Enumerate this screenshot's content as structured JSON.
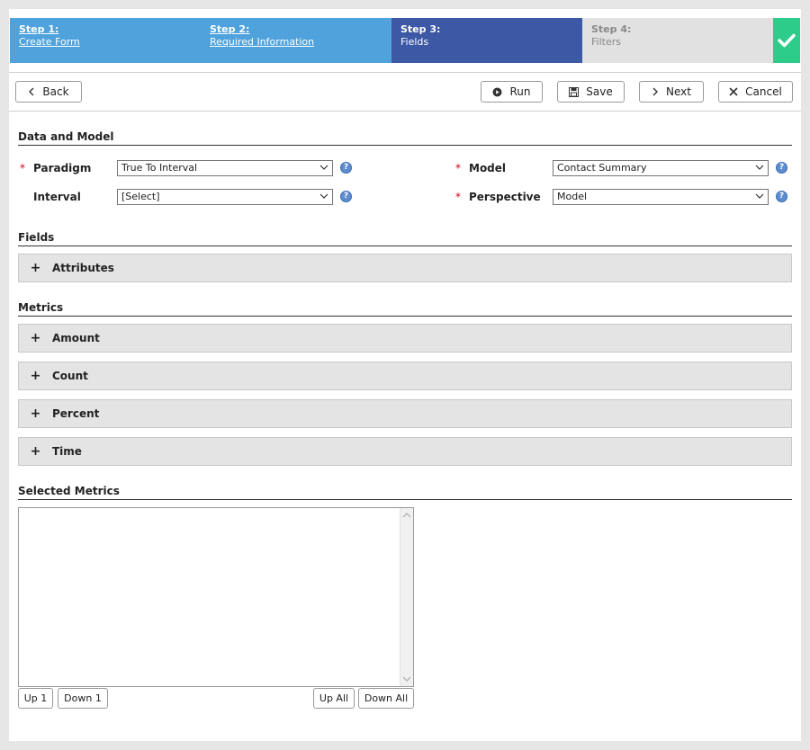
{
  "wizard": {
    "steps": [
      {
        "title": "Step 1:",
        "name": "Create Form"
      },
      {
        "title": "Step 2:",
        "name": "Required Information"
      },
      {
        "title": "Step 3:",
        "name": "Fields"
      },
      {
        "title": "Step 4:",
        "name": "Filters"
      }
    ],
    "active_step": 3,
    "check_icon": "check-icon",
    "colors": {
      "done": "#4fa2db",
      "active": "#3d58a4",
      "pending": "#e1e1e1",
      "check": "#2ecc8a"
    }
  },
  "toolbar": {
    "back_label": "Back",
    "run_label": "Run",
    "save_label": "Save",
    "next_label": "Next",
    "cancel_label": "Cancel"
  },
  "data_model": {
    "heading": "Data and Model",
    "required_mark": "*",
    "paradigm": {
      "label": "Paradigm",
      "value": "True To Interval"
    },
    "interval": {
      "label": "Interval",
      "value": "[Select]"
    },
    "model": {
      "label": "Model",
      "value": "Contact Summary"
    },
    "perspective": {
      "label": "Perspective",
      "value": "Model"
    },
    "help_glyph": "?"
  },
  "fields": {
    "heading": "Fields",
    "groups": [
      {
        "label": "Attributes"
      }
    ]
  },
  "metrics": {
    "heading": "Metrics",
    "groups": [
      {
        "label": "Amount"
      },
      {
        "label": "Count"
      },
      {
        "label": "Percent"
      },
      {
        "label": "Time"
      }
    ]
  },
  "expand_glyph": "+",
  "selected_metrics": {
    "heading": "Selected Metrics",
    "items": [],
    "up1_label": "Up 1",
    "down1_label": "Down 1",
    "upall_label": "Up All",
    "downall_label": "Down All"
  }
}
